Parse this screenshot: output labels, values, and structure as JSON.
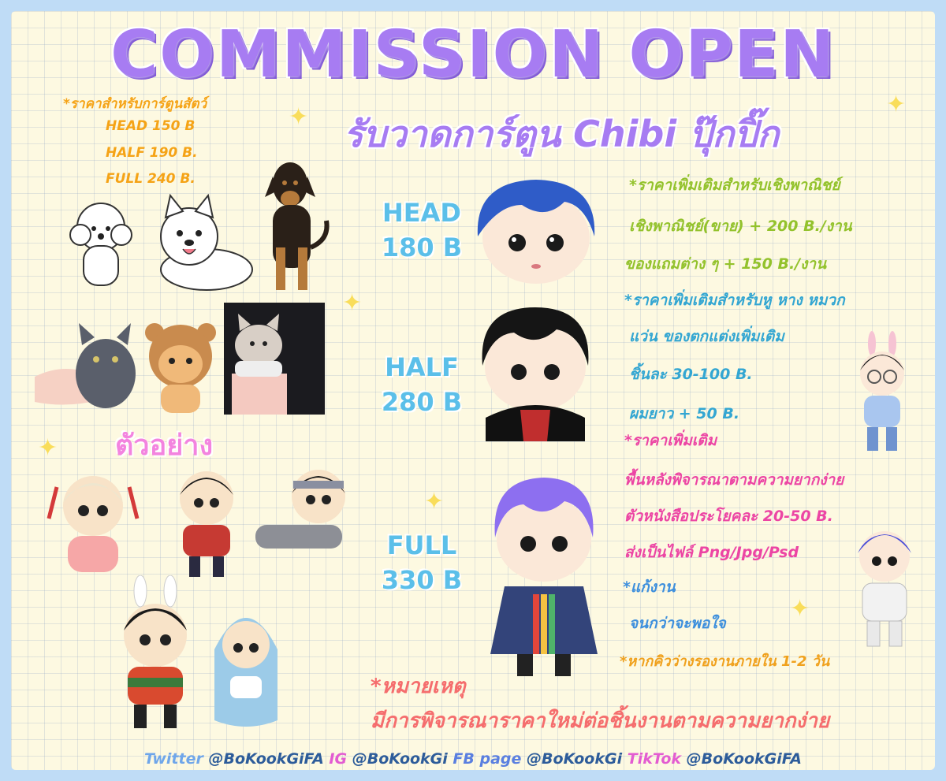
{
  "title": "COMMISSION OPEN",
  "subtitle": "รับวาดการ์ตูน Chibi ปุ๊กปิ๊ก",
  "animal_prices": {
    "heading": "*ราคาสำหรับการ์ตูนสัตว์",
    "head": "HEAD 150 B",
    "half": "HALF 190 B.",
    "full": "FULL 240 B."
  },
  "tiers": [
    {
      "name": "HEAD",
      "price": "180 B"
    },
    {
      "name": "HALF",
      "price": "280 B"
    },
    {
      "name": "FULL",
      "price": "330 B"
    }
  ],
  "details": {
    "commercial_heading": "*ราคาเพิ่มเติมสำหรับเชิงพาณิชย์",
    "commercial_sell": "เชิงพาณิชย์(ขาย) + 200 B./งาน",
    "commercial_merch": "ของแถมต่าง ๆ + 150 B./งาน",
    "extras_heading": "*ราคาเพิ่มเติมสำหรับหู หาง หมวก",
    "extras_line": "แว่น ของตกแต่งเพิ่มเติม",
    "extras_price": "ชิ้นละ 30-100 B.",
    "long_hair": "ผมยาว + 50 B.",
    "more_heading": "*ราคาเพิ่มเติม",
    "background": "พื้นหลังพิจารณาตามความยากง่าย",
    "text_price": "ตัวหนังสือประโยคละ 20-50 B.",
    "file_types": "ส่งเป็นไฟล์ Png/Jpg/Psd",
    "revision_heading": "*แก้งาน",
    "revision_line": "จนกว่าจะพอใจ",
    "queue": "*หากคิวว่างรองานภายใน 1-2 วัน"
  },
  "example_label": "ตัวอย่าง",
  "note": {
    "heading": "*หมายเหตุ",
    "line": "มีการพิจารณาราคาใหม่ต่อชิ้นงานตามความยากง่าย"
  },
  "footer": {
    "twitter_label": "Twitter",
    "twitter_handle": "@BoKookGiFA",
    "ig_label": "IG",
    "ig_handle": "@BoKookGi",
    "fb_label": "FB page",
    "fb_handle": "@BoKookGi",
    "tiktok_label": "TikTok",
    "tiktok_handle": "@BoKookGiFA"
  },
  "colors": {
    "title": "#a77cf2",
    "tier": "#5bbfe9",
    "commercial": "#93c22c",
    "extras": "#33a6d2",
    "more": "#ec45a4",
    "note": "#f56d6d"
  }
}
